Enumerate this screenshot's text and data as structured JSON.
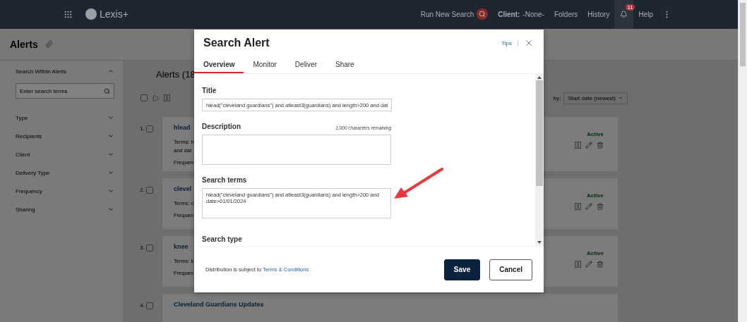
{
  "topbar": {
    "logo": "Lexis+",
    "run_search": "Run New Search",
    "client_label": "Client:",
    "client_value": "-None-",
    "links": [
      "Folders",
      "History"
    ],
    "notification_count": "11",
    "help": "Help"
  },
  "page": {
    "title": "Alerts"
  },
  "sidebar": {
    "heading": "Search Within Alerts",
    "expanded": true,
    "search_placeholder": "Enter search terms",
    "filters": [
      {
        "label": "Type",
        "expanded": false
      },
      {
        "label": "Recipients",
        "expanded": false
      },
      {
        "label": "Client",
        "expanded": false
      },
      {
        "label": "Delivery Type",
        "expanded": false
      },
      {
        "label": "Frequency",
        "expanded": false
      },
      {
        "label": "Sharing",
        "expanded": false
      }
    ]
  },
  "alerts": {
    "heading": "Alerts (18",
    "select_all_checked": false,
    "sort_label": "by:",
    "sort_value": "Start date (newest)",
    "items": [
      {
        "number": "1.",
        "checked": false,
        "title": "hlead",
        "terms": [
          "Terms: h",
          "and dat"
        ],
        "frequency": "Frequen",
        "status": "Active"
      },
      {
        "number": "2.",
        "checked": false,
        "title": "clevel",
        "terms": [
          "Terms: c"
        ],
        "frequency": "Frequen",
        "status": "Active"
      },
      {
        "number": "3.",
        "checked": false,
        "title": "knee",
        "terms": [
          "Terms: k"
        ],
        "frequency": "Frequen",
        "status": "Active"
      },
      {
        "number": "4.",
        "checked": false,
        "title": "Cleveland Guardians Updates"
      }
    ]
  },
  "dialog": {
    "title": "Search Alert",
    "tips": "Tips",
    "tabs": [
      {
        "label": "Overview",
        "selected": true
      },
      {
        "label": "Monitor",
        "selected": false
      },
      {
        "label": "Deliver",
        "selected": false
      },
      {
        "label": "Share",
        "selected": false
      }
    ],
    "title_label": "Title",
    "title_value": "hlead(\"cleveland guardians\") and atleast3(guardians) and length>200 and dat",
    "description_label": "Description",
    "description_counter": "1,000 characters remaining",
    "search_terms_label": "Search terms",
    "search_terms_value": "hlead(\"cleveland guardians\") and atleast3(guardians) and length>200 and date>01/01/2024",
    "search_type_label": "Search type",
    "footer_text": "Distribution is subject to ",
    "footer_link": "Terms & Conditions",
    "buttons": [
      {
        "label": "Save",
        "kind": "primary"
      },
      {
        "label": "Cancel",
        "kind": "secondary"
      }
    ]
  }
}
